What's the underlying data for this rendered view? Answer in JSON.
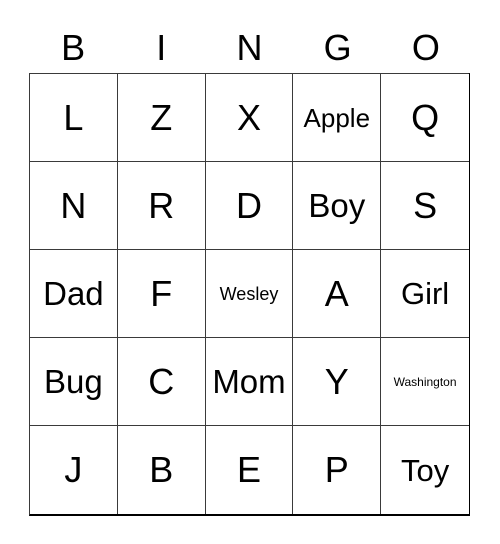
{
  "card": {
    "title": "BINGO",
    "headers": [
      "B",
      "I",
      "N",
      "G",
      "O"
    ],
    "rows": [
      [
        {
          "text": "L",
          "size": "xl"
        },
        {
          "text": "Z",
          "size": "xl"
        },
        {
          "text": "X",
          "size": "xl"
        },
        {
          "text": "Apple",
          "size": "sm"
        },
        {
          "text": "Q",
          "size": "xl"
        }
      ],
      [
        {
          "text": "N",
          "size": "xl"
        },
        {
          "text": "R",
          "size": "xl"
        },
        {
          "text": "D",
          "size": "xl"
        },
        {
          "text": "Boy",
          "size": "lg"
        },
        {
          "text": "S",
          "size": "xl"
        }
      ],
      [
        {
          "text": "Dad",
          "size": "lg"
        },
        {
          "text": "F",
          "size": "xl"
        },
        {
          "text": "Wesley",
          "size": "xs"
        },
        {
          "text": "A",
          "size": "xl"
        },
        {
          "text": "Girl",
          "size": "md"
        }
      ],
      [
        {
          "text": "Bug",
          "size": "lg"
        },
        {
          "text": "C",
          "size": "xl"
        },
        {
          "text": "Mom",
          "size": "lg"
        },
        {
          "text": "Y",
          "size": "xl"
        },
        {
          "text": "Washington",
          "size": "xxs"
        }
      ],
      [
        {
          "text": "J",
          "size": "xl"
        },
        {
          "text": "B",
          "size": "xl"
        },
        {
          "text": "E",
          "size": "xl"
        },
        {
          "text": "P",
          "size": "xl"
        },
        {
          "text": "Toy",
          "size": "md"
        }
      ]
    ]
  },
  "colors": {
    "background": "#ffffff",
    "text": "#000000",
    "grid_line": "#3a3a3a",
    "outer_border": "#000000"
  }
}
